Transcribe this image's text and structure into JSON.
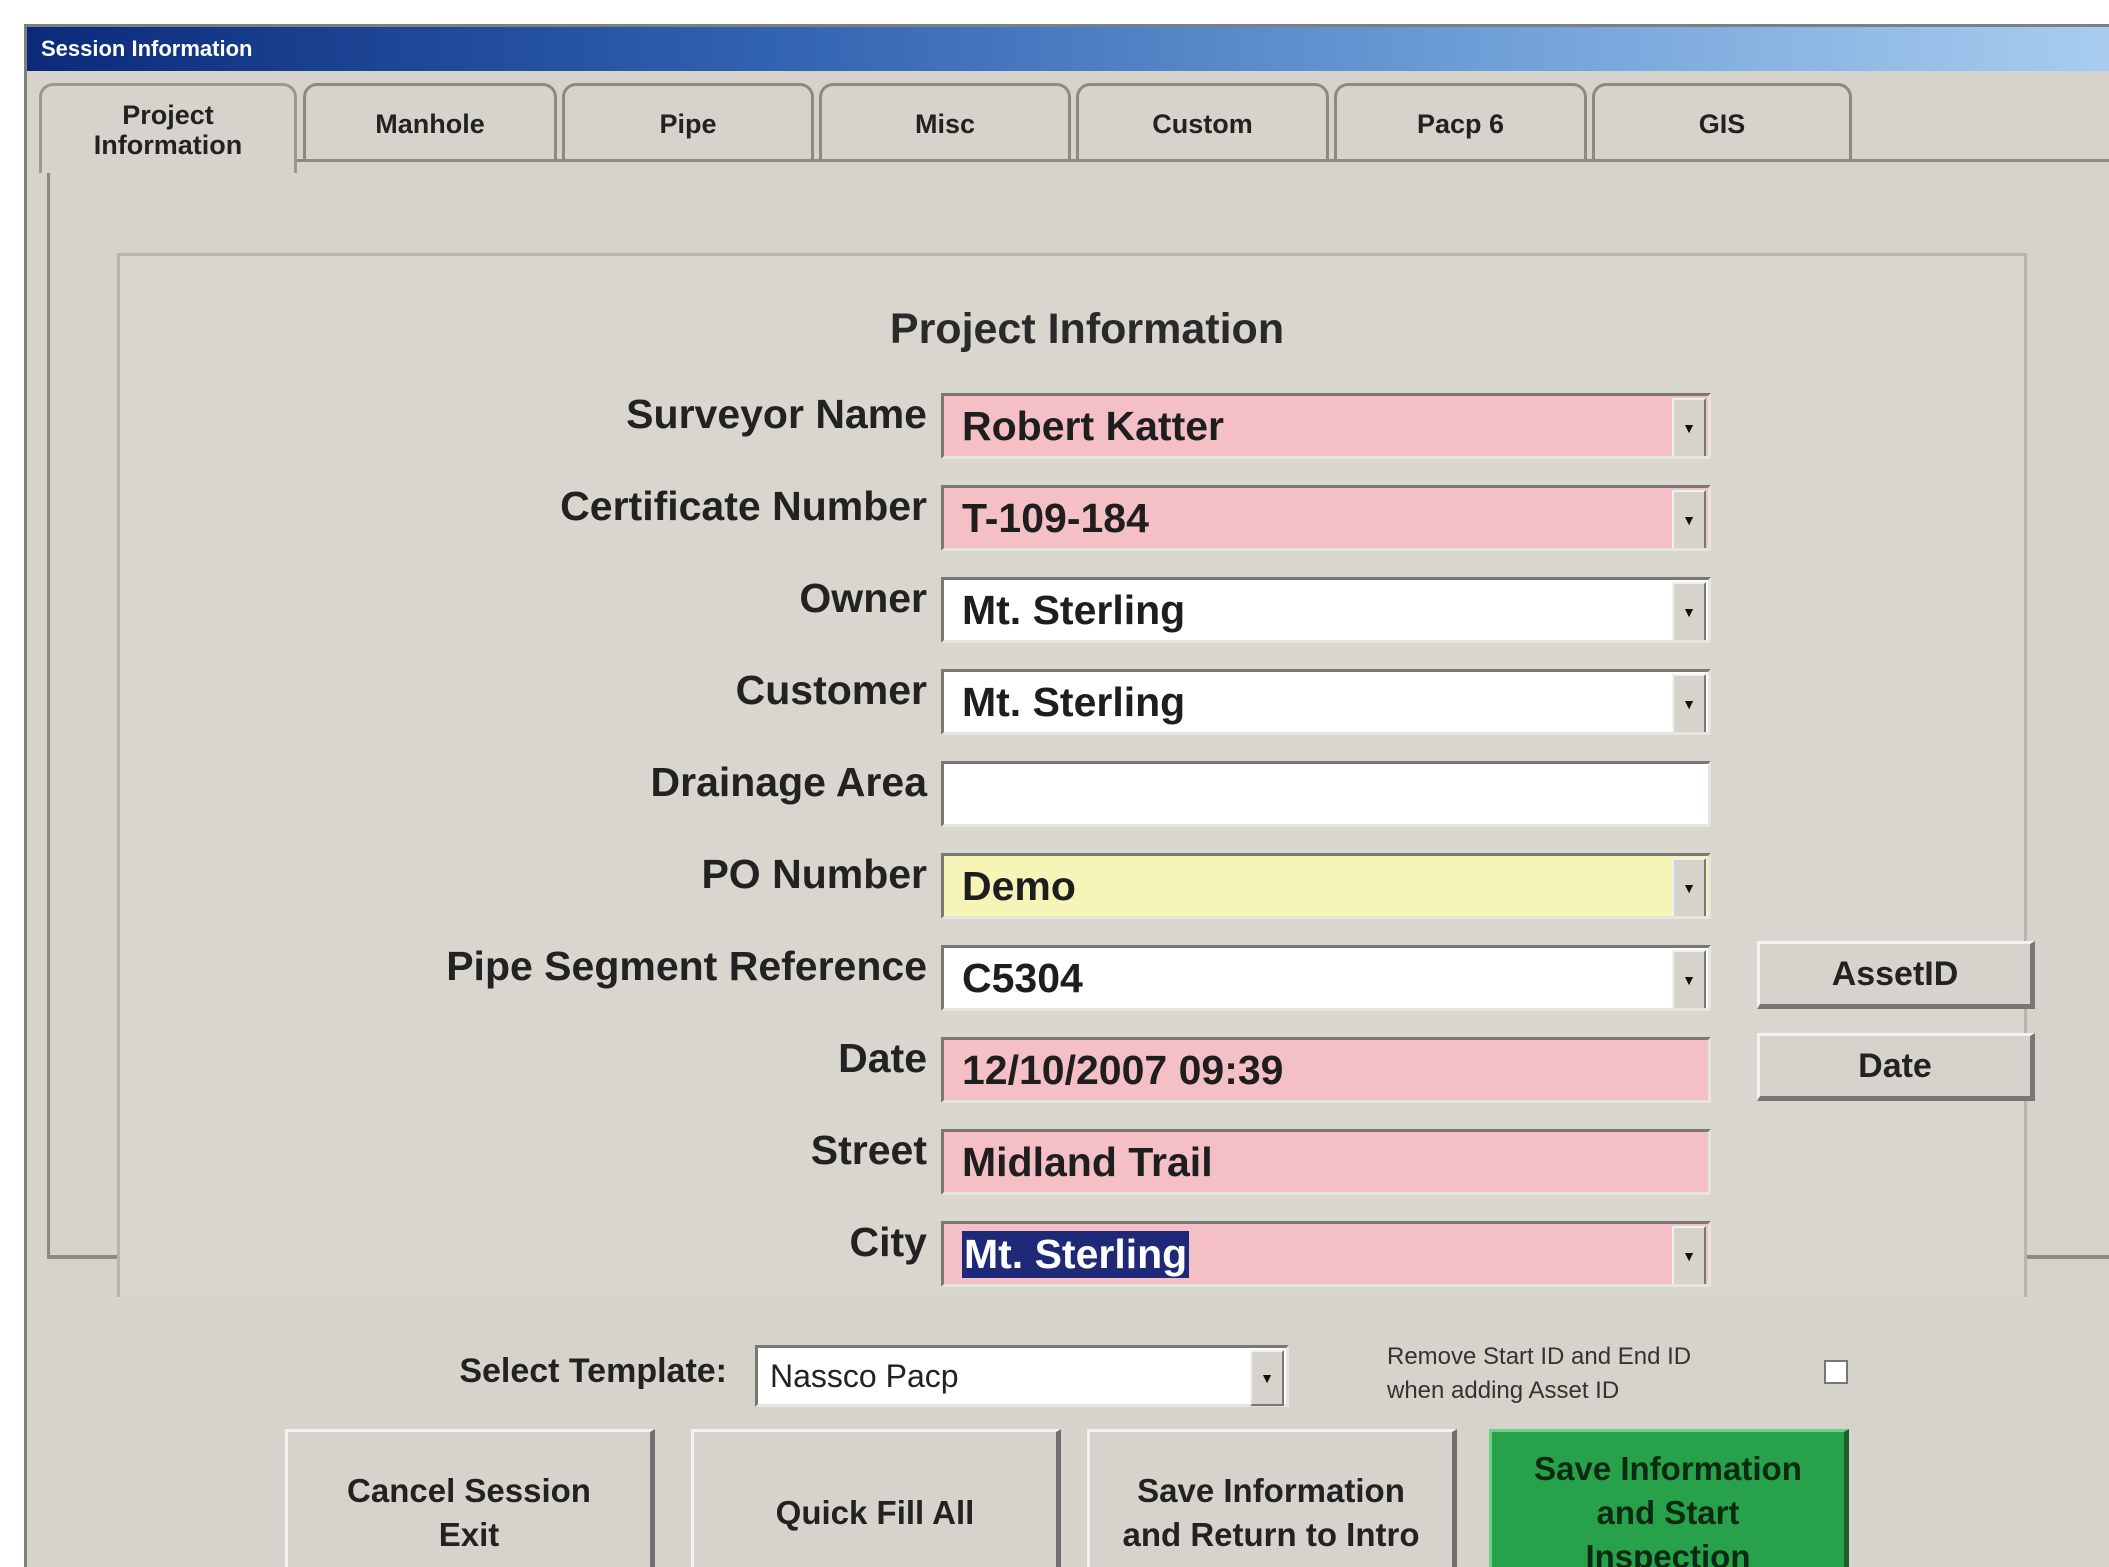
{
  "window": {
    "title": "Session Information"
  },
  "tabs": [
    {
      "label": "Project\nInformation",
      "active": true
    },
    {
      "label": "Manhole",
      "active": false
    },
    {
      "label": "Pipe",
      "active": false
    },
    {
      "label": "Misc",
      "active": false
    },
    {
      "label": "Custom",
      "active": false
    },
    {
      "label": "Pacp 6",
      "active": false
    },
    {
      "label": "GIS",
      "active": false
    }
  ],
  "section_title": "Project Information",
  "fields": {
    "surveyor_name": {
      "label": "Surveyor Name",
      "value": "Robert Katter"
    },
    "certificate_number": {
      "label": "Certificate Number",
      "value": "T-109-184"
    },
    "owner": {
      "label": "Owner",
      "value": "Mt. Sterling"
    },
    "customer": {
      "label": "Customer",
      "value": "Mt. Sterling"
    },
    "drainage_area": {
      "label": "Drainage Area",
      "value": ""
    },
    "po_number": {
      "label": "PO Number",
      "value": "Demo"
    },
    "pipe_segment_reference": {
      "label": "Pipe Segment Reference",
      "value": "C5304"
    },
    "date": {
      "label": "Date",
      "value": "12/10/2007 09:39"
    },
    "street": {
      "label": "Street",
      "value": "Midland Trail"
    },
    "city": {
      "label": "City",
      "value": "Mt. Sterling"
    }
  },
  "side_buttons": {
    "asset_id": "AssetID",
    "date": "Date"
  },
  "template": {
    "label": "Select Template:",
    "value": "Nassco Pacp"
  },
  "remove_option": {
    "label": "Remove Start ID and End ID\nwhen adding Asset ID",
    "checked": false
  },
  "buttons": {
    "cancel": "Cancel Session\nExit",
    "quick_fill": "Quick Fill All",
    "save_return": "Save Information\nand Return to Intro",
    "save_start": "Save Information\nand Start\nInspection"
  },
  "colors": {
    "required_field": "#f4bfc5",
    "po_field": "#f6f4b7",
    "start_button": "#27a24a",
    "selection": "#1e2a78"
  },
  "icons": {
    "dropdown": "chevron-down-icon"
  }
}
